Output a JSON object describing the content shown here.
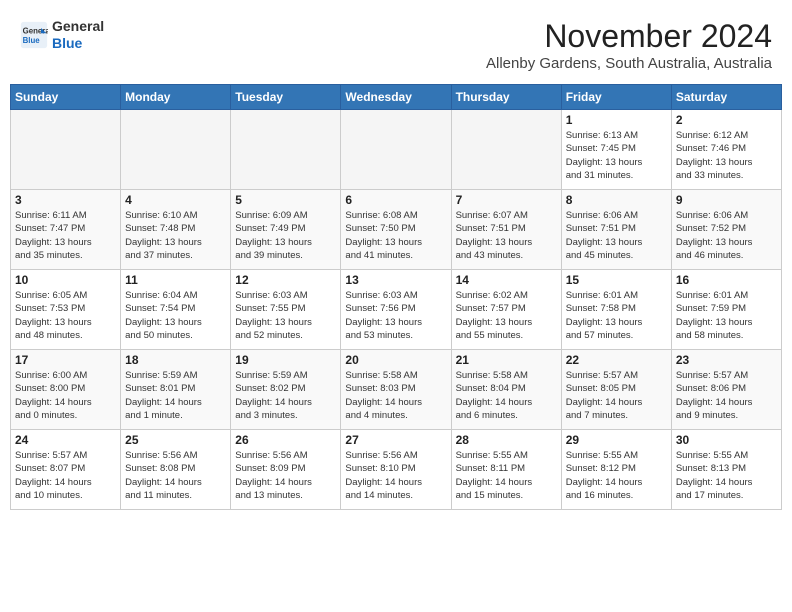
{
  "header": {
    "logo_line1": "General",
    "logo_line2": "Blue",
    "month_title": "November 2024",
    "location": "Allenby Gardens, South Australia, Australia"
  },
  "calendar": {
    "days_of_week": [
      "Sunday",
      "Monday",
      "Tuesday",
      "Wednesday",
      "Thursday",
      "Friday",
      "Saturday"
    ],
    "weeks": [
      [
        {
          "day": "",
          "info": ""
        },
        {
          "day": "",
          "info": ""
        },
        {
          "day": "",
          "info": ""
        },
        {
          "day": "",
          "info": ""
        },
        {
          "day": "",
          "info": ""
        },
        {
          "day": "1",
          "info": "Sunrise: 6:13 AM\nSunset: 7:45 PM\nDaylight: 13 hours\nand 31 minutes."
        },
        {
          "day": "2",
          "info": "Sunrise: 6:12 AM\nSunset: 7:46 PM\nDaylight: 13 hours\nand 33 minutes."
        }
      ],
      [
        {
          "day": "3",
          "info": "Sunrise: 6:11 AM\nSunset: 7:47 PM\nDaylight: 13 hours\nand 35 minutes."
        },
        {
          "day": "4",
          "info": "Sunrise: 6:10 AM\nSunset: 7:48 PM\nDaylight: 13 hours\nand 37 minutes."
        },
        {
          "day": "5",
          "info": "Sunrise: 6:09 AM\nSunset: 7:49 PM\nDaylight: 13 hours\nand 39 minutes."
        },
        {
          "day": "6",
          "info": "Sunrise: 6:08 AM\nSunset: 7:50 PM\nDaylight: 13 hours\nand 41 minutes."
        },
        {
          "day": "7",
          "info": "Sunrise: 6:07 AM\nSunset: 7:51 PM\nDaylight: 13 hours\nand 43 minutes."
        },
        {
          "day": "8",
          "info": "Sunrise: 6:06 AM\nSunset: 7:51 PM\nDaylight: 13 hours\nand 45 minutes."
        },
        {
          "day": "9",
          "info": "Sunrise: 6:06 AM\nSunset: 7:52 PM\nDaylight: 13 hours\nand 46 minutes."
        }
      ],
      [
        {
          "day": "10",
          "info": "Sunrise: 6:05 AM\nSunset: 7:53 PM\nDaylight: 13 hours\nand 48 minutes."
        },
        {
          "day": "11",
          "info": "Sunrise: 6:04 AM\nSunset: 7:54 PM\nDaylight: 13 hours\nand 50 minutes."
        },
        {
          "day": "12",
          "info": "Sunrise: 6:03 AM\nSunset: 7:55 PM\nDaylight: 13 hours\nand 52 minutes."
        },
        {
          "day": "13",
          "info": "Sunrise: 6:03 AM\nSunset: 7:56 PM\nDaylight: 13 hours\nand 53 minutes."
        },
        {
          "day": "14",
          "info": "Sunrise: 6:02 AM\nSunset: 7:57 PM\nDaylight: 13 hours\nand 55 minutes."
        },
        {
          "day": "15",
          "info": "Sunrise: 6:01 AM\nSunset: 7:58 PM\nDaylight: 13 hours\nand 57 minutes."
        },
        {
          "day": "16",
          "info": "Sunrise: 6:01 AM\nSunset: 7:59 PM\nDaylight: 13 hours\nand 58 minutes."
        }
      ],
      [
        {
          "day": "17",
          "info": "Sunrise: 6:00 AM\nSunset: 8:00 PM\nDaylight: 14 hours\nand 0 minutes."
        },
        {
          "day": "18",
          "info": "Sunrise: 5:59 AM\nSunset: 8:01 PM\nDaylight: 14 hours\nand 1 minute."
        },
        {
          "day": "19",
          "info": "Sunrise: 5:59 AM\nSunset: 8:02 PM\nDaylight: 14 hours\nand 3 minutes."
        },
        {
          "day": "20",
          "info": "Sunrise: 5:58 AM\nSunset: 8:03 PM\nDaylight: 14 hours\nand 4 minutes."
        },
        {
          "day": "21",
          "info": "Sunrise: 5:58 AM\nSunset: 8:04 PM\nDaylight: 14 hours\nand 6 minutes."
        },
        {
          "day": "22",
          "info": "Sunrise: 5:57 AM\nSunset: 8:05 PM\nDaylight: 14 hours\nand 7 minutes."
        },
        {
          "day": "23",
          "info": "Sunrise: 5:57 AM\nSunset: 8:06 PM\nDaylight: 14 hours\nand 9 minutes."
        }
      ],
      [
        {
          "day": "24",
          "info": "Sunrise: 5:57 AM\nSunset: 8:07 PM\nDaylight: 14 hours\nand 10 minutes."
        },
        {
          "day": "25",
          "info": "Sunrise: 5:56 AM\nSunset: 8:08 PM\nDaylight: 14 hours\nand 11 minutes."
        },
        {
          "day": "26",
          "info": "Sunrise: 5:56 AM\nSunset: 8:09 PM\nDaylight: 14 hours\nand 13 minutes."
        },
        {
          "day": "27",
          "info": "Sunrise: 5:56 AM\nSunset: 8:10 PM\nDaylight: 14 hours\nand 14 minutes."
        },
        {
          "day": "28",
          "info": "Sunrise: 5:55 AM\nSunset: 8:11 PM\nDaylight: 14 hours\nand 15 minutes."
        },
        {
          "day": "29",
          "info": "Sunrise: 5:55 AM\nSunset: 8:12 PM\nDaylight: 14 hours\nand 16 minutes."
        },
        {
          "day": "30",
          "info": "Sunrise: 5:55 AM\nSunset: 8:13 PM\nDaylight: 14 hours\nand 17 minutes."
        }
      ]
    ]
  }
}
